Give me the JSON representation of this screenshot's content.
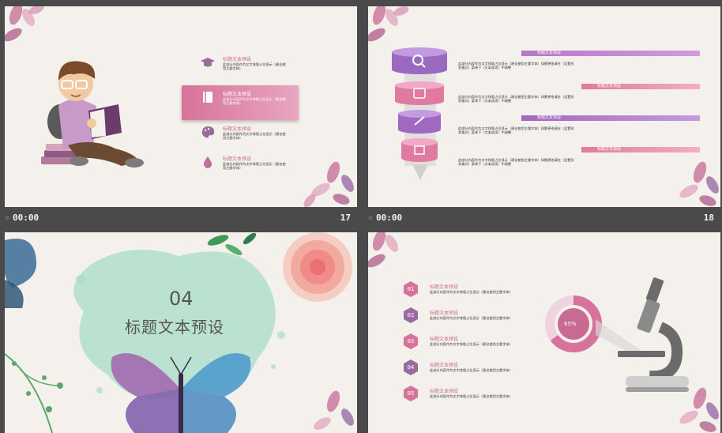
{
  "slides": [
    {
      "number": "17",
      "time": "00:00",
      "menu": [
        {
          "title": "标题文本预设",
          "desc": "此部分内容作为文字排版占位显示（建议使用主题字体）",
          "icon": "graduation-cap-icon"
        },
        {
          "title": "标题文本预设",
          "desc": "此部分内容作为文字排版占位显示（建议使用主题字体）",
          "icon": "book-icon"
        },
        {
          "title": "标题文本预设",
          "desc": "此部分内容作为文字排版占位显示（建议使用主题字体）",
          "icon": "palette-icon"
        },
        {
          "title": "标题文本预设",
          "desc": "此部分内容作为文字排版占位显示（建议使用主题字体）",
          "icon": "droplet-icon"
        }
      ]
    },
    {
      "number": "18",
      "time": "00:00",
      "rows": [
        {
          "title": "标题文本预设",
          "desc": "此部分内容作为文字排版占位显示（建议使用主题字体）如需更改请在（设置形状格式）菜单下（文本选项）中调整"
        },
        {
          "title": "标题文本预设",
          "desc": "此部分内容作为文字排版占位显示（建议使用主题字体）如需更改请在（设置形状格式）菜单下（文本选项）中调整"
        },
        {
          "title": "标题文本预设",
          "desc": "此部分内容作为文字排版占位显示（建议使用主题字体）如需更改请在（设置形状格式）菜单下（文本选项）中调整"
        },
        {
          "title": "标题文本预设",
          "desc": "此部分内容作为文字排版占位显示（建议使用主题字体）如需更改请在（设置形状格式）菜单下（文本选项）中调整"
        }
      ]
    },
    {
      "section_number": "04",
      "section_title": "标题文本预设"
    },
    {
      "center_label": "65%",
      "items": [
        {
          "num": "01",
          "title": "标题文本预设",
          "desc": "此部分内容作为文字排版占位显示（建议使用主题字体）"
        },
        {
          "num": "02",
          "title": "标题文本预设",
          "desc": "此部分内容作为文字排版占位显示（建议使用主题字体）"
        },
        {
          "num": "03",
          "title": "标题文本预设",
          "desc": "此部分内容作为文字排版占位显示（建议使用主题字体）"
        },
        {
          "num": "04",
          "title": "标题文本预设",
          "desc": "此部分内容作为文字排版占位显示（建议使用主题字体）"
        },
        {
          "num": "05",
          "title": "标题文本预设",
          "desc": "此部分内容作为文字排版占位显示（建议使用主题字体）"
        }
      ]
    }
  ],
  "colors": {
    "accent": "#d7739a",
    "purple": "#8a5a9e",
    "bar": "#4a4a4a"
  }
}
